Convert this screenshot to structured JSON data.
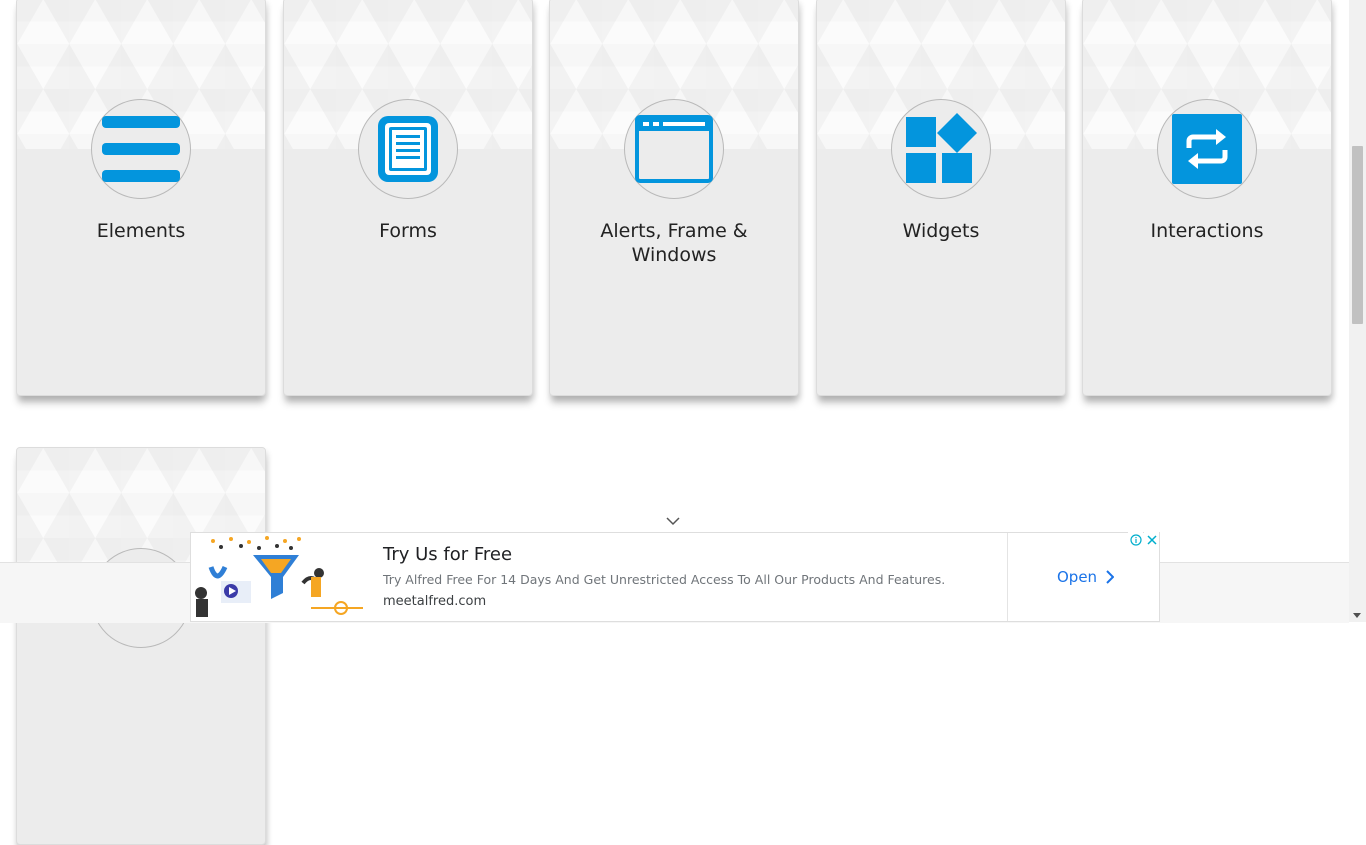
{
  "colors": {
    "accent": "#0395dd",
    "card_bg": "#ececec",
    "link": "#1a73e8"
  },
  "cards": [
    {
      "title": "Elements",
      "icon": "list-icon"
    },
    {
      "title": "Forms",
      "icon": "document-icon"
    },
    {
      "title": "Alerts, Frame & Windows",
      "icon": "browser-window-icon"
    },
    {
      "title": "Widgets",
      "icon": "widgets-icon"
    },
    {
      "title": "Interactions",
      "icon": "swap-arrows-icon"
    }
  ],
  "ad": {
    "title": "Try Us for Free",
    "description": "Try Alfred Free For 14 Days And Get Unrestricted Access To All Our Products And Features.",
    "url": "meetalfred.com",
    "open_label": "Open"
  }
}
